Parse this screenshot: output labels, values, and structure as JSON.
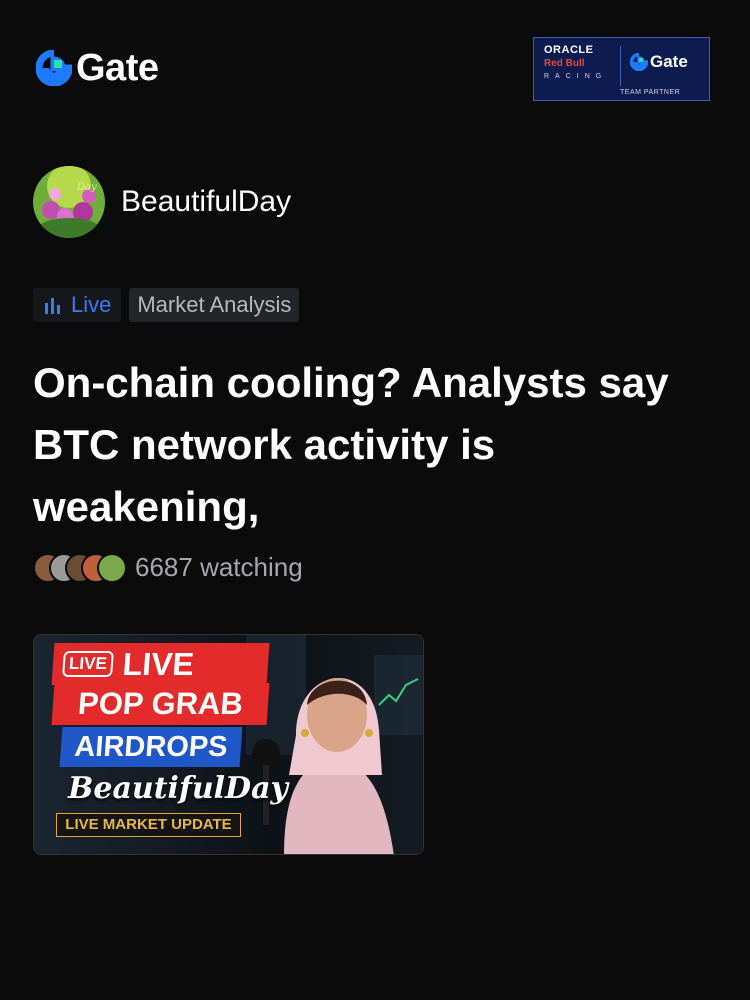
{
  "brand": {
    "name": "Gate",
    "accent": "#1e7bff",
    "highlight": "#2be0a6"
  },
  "partner_badge": {
    "line1": "ORACLE",
    "line2": "Red Bull",
    "line3": "RACING",
    "brand": "Gate",
    "footer": "TEAM PARTNER"
  },
  "author": {
    "name": "BeautifulDay",
    "avatar_icon": "flower-avatar"
  },
  "tags": {
    "live_label": "Live",
    "live_color": "#3a7bf4",
    "category": "Market Analysis"
  },
  "post": {
    "title": "On-chain cooling? Analysts say BTC network activity is weakening,"
  },
  "audience": {
    "watching": "6687 watching",
    "avatar_count": 5
  },
  "thumbnail": {
    "live_pill": "LIVE",
    "live_text": "LIVE",
    "line1": "POP GRAB",
    "line2": "AIRDROPS",
    "script_name": "BeautifulDay",
    "subtitle": "LIVE MARKET UPDATE"
  }
}
